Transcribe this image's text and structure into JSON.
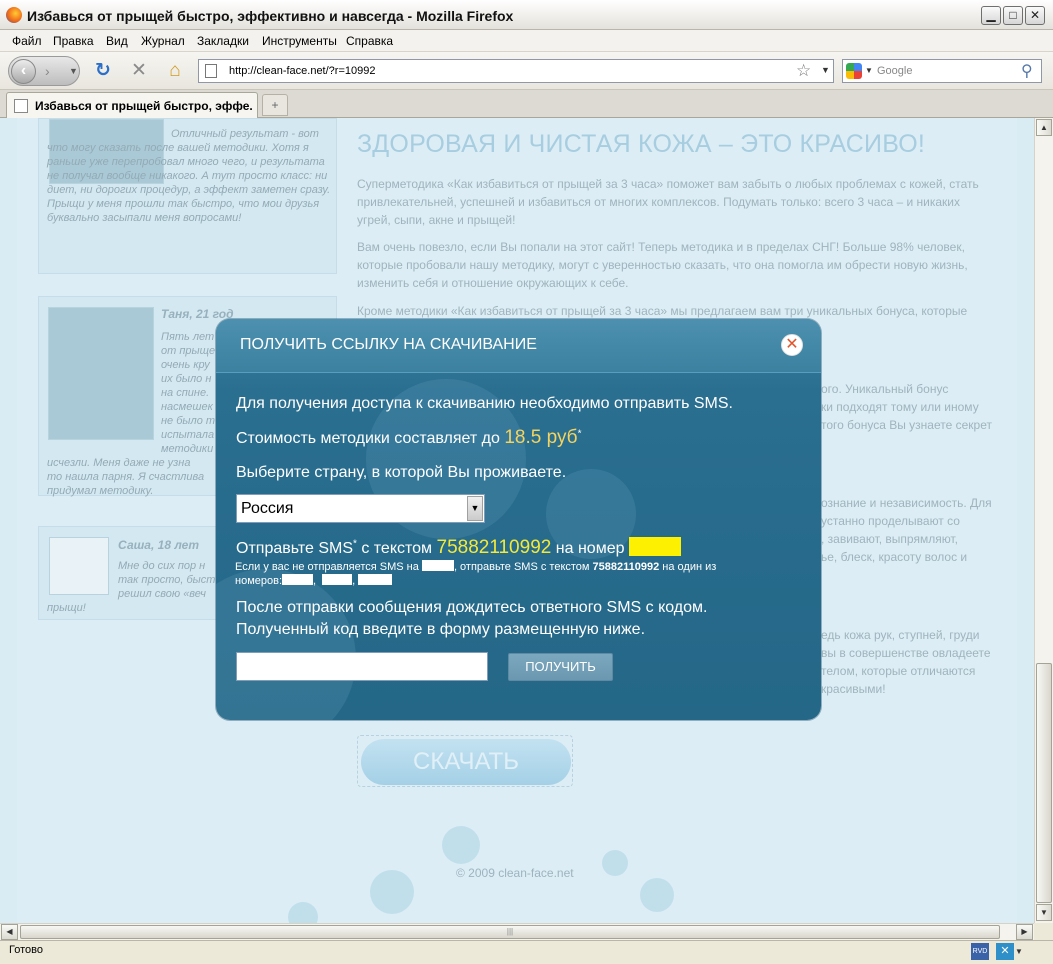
{
  "window": {
    "title": "Избавься от прыщей быстро, эффективно и навсегда - Mozilla Firefox"
  },
  "menu": [
    "Файл",
    "Правка",
    "Вид",
    "Журнал",
    "Закладки",
    "Инструменты",
    "Справка"
  ],
  "nav": {
    "url": "http://clean-face.net/?r=10992",
    "search_placeholder": "Google"
  },
  "tab": {
    "title": "Избавься от прыщей быстро, эффе..."
  },
  "page": {
    "testimonial1": {
      "text": "Отличный результат - вот что могу сказать после вашей методики. Хотя я раньше уже перепробовал много чего, и результата не получал вообще никакого. А тут просто класс: ни диет, ни дорогих процедур, а эффект заметен сразу. Прыщи у меня прошли так быстро, что мои друзья буквально засыпали меня вопросами!"
    },
    "testimonial2": {
      "name": "Таня, 21 год",
      "text_top": "Пять лет\nот прыще\nочень кру\nих было н\nна спине.\nнасмешек\nне было т\nиспытала\nметодики",
      "text_bottom": "исчезли. Меня даже не узна\nто нашла парня. Я счастлива\nпридумал методику."
    },
    "testimonial3": {
      "name": "Саша, 18 лет",
      "text_top": "Мне до сих пор н\nтак просто, быст\nрешил свою «веч",
      "text_bottom": "прыщи!"
    },
    "headline": "ЗДОРОВАЯ И ЧИСТАЯ КОЖА – ЭТО КРАСИВО!",
    "p1": "Суперметодика «Как избавиться от прыщей за 3 часа» поможет вам забыть о любых проблемах с кожей, стать привлекательней, успешней и избавиться от многих комплексов. Подумать только: всего 3 часа – и никаких угрей, сыпи, акне и прыщей!",
    "p2": "Вам очень повезло, если Вы попали на этот сайт! Теперь методика и в пределах СНГ! Больше 98% человек, которые пробовали нашу методику, могут с уверенностью сказать, что она помогла им обрести новую жизнь, изменить себя и отношение окружающих к себе.",
    "p3": "Кроме методики «Как избавиться от прыщей за 3 часа» мы предлагаем вам три уникальных бонуса, которые",
    "frag_a1": "ого. Уникальный бонус",
    "frag_a2": "ки подходят тому или иному",
    "frag_a3": "того бонуса Вы узнаете секрет",
    "frag_b1": "ознание и независимость. Для",
    "frag_b2": "устанно проделывают со",
    "frag_b3": ", завивают, выпрямляют,",
    "frag_b4": "ье, блеск, красоту волос и",
    "frag_c1": "едь кожа рук, ступней, груди",
    "frag_c2": "вы в совершенстве овладеете",
    "frag_c3": "телом, которые отличаются",
    "frag_c4": "красивыми!",
    "download_label": "СКАЧАТЬ",
    "footer": "© 2009 clean-face.net"
  },
  "modal": {
    "title": "ПОЛУЧИТЬ ССЫЛКУ НА СКАЧИВАНИЕ",
    "close_symbol": "✕",
    "line1": "Для получения доступа к скачиванию необходимо отправить SMS.",
    "price_prefix": "Стоимость методики составляет до ",
    "price_value": "18.5 руб",
    "asterisk": "*",
    "country_prompt": "Выберите страну, в которой Вы проживаете.",
    "country_selected": "Россия",
    "send_prefix": "Отправьте SMS",
    "send_mid": " с текстом ",
    "sms_code": "75882110992",
    "send_suffix": " на номер ",
    "small_a": "Если у вас не отправляется SMS на ",
    "small_b": ", отправьте SMS с текстом ",
    "small_code": "75882110992",
    "small_c": " на один из",
    "small_d": "номеров:",
    "small_sep": ",",
    "after1": "После отправки сообщения дождитесь ответного SMS с кодом.",
    "after2": "Полученный код введите в форму размещенную ниже.",
    "code_value": "",
    "submit_label": "ПОЛУЧИТЬ"
  },
  "status": {
    "text": "Готово"
  },
  "colors": {
    "modal_bg": "#2a6e90",
    "accent_price": "#f4d35e",
    "accent_code": "#f3e93a",
    "number_highlight": "#fdf000"
  }
}
